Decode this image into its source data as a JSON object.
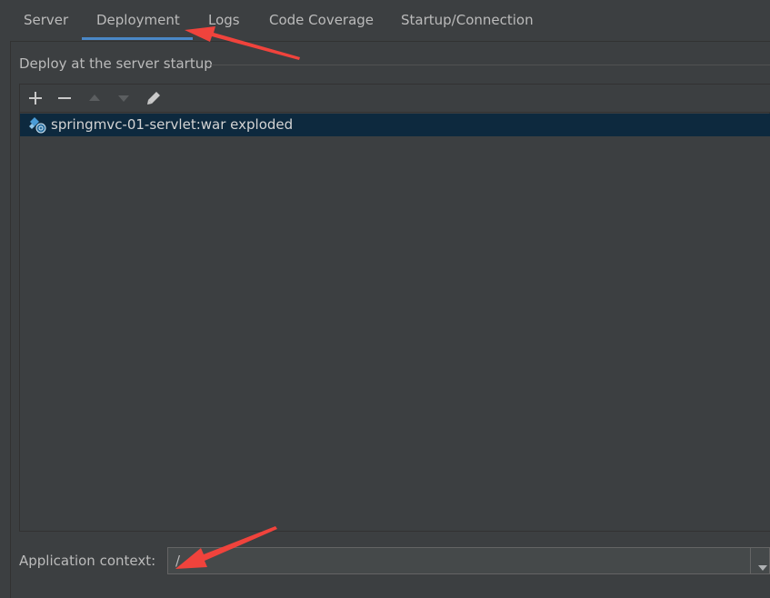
{
  "tabs": [
    {
      "label": "Server",
      "active": false
    },
    {
      "label": "Deployment",
      "active": true
    },
    {
      "label": "Logs",
      "active": false
    },
    {
      "label": "Code Coverage",
      "active": false
    },
    {
      "label": "Startup/Connection",
      "active": false
    }
  ],
  "deploy_group": {
    "title": "Deploy at the server startup",
    "toolbar": {
      "add_icon": "plus-icon",
      "remove_icon": "minus-icon",
      "move_up_icon": "arrow-up-icon",
      "move_down_icon": "arrow-down-icon",
      "edit_icon": "pencil-icon"
    },
    "artifacts": [
      {
        "label": "springmvc-01-servlet:war exploded",
        "icon": "artifact-war-exploded-icon",
        "selected": true
      }
    ]
  },
  "application_context": {
    "label": "Application context:",
    "value": "/"
  },
  "colors": {
    "background": "#3c3f41",
    "tab_underline": "#4a88c7",
    "selection": "#0d293e",
    "annotation_arrow": "#f0433c"
  }
}
